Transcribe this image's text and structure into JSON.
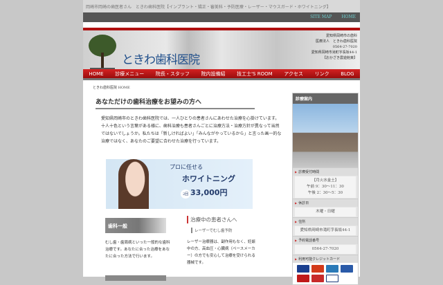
{
  "topbar": {
    "text": "岡崎市岡崎の歯医者さん　ときわ歯科医院【インプラント・矯正・審美科・予防医療・レーザー・マウスガード・ホワイトニング】"
  },
  "util": {
    "sitemap": "SITE MAP",
    "home": "HOME"
  },
  "header": {
    "logo": "ときわ歯科医院",
    "addr": [
      "愛知県岡崎市の歯科",
      "医療法人　ときわ歯科医院",
      "0564-27-7020",
      "愛知県岡崎市滝町字長坂44-1",
      "【おかざき農遊館東】"
    ]
  },
  "nav": [
    "HOME",
    "診療メニュー",
    "院長・スタッフ",
    "院内設備紹",
    "技工士'S ROOM",
    "アクセス",
    "リンク",
    "BLOG"
  ],
  "breadcrumb": "ときわ歯科医院 HOME",
  "main": {
    "heading": "あなただけの歯科治療をお望みの方へ",
    "intro": "愛知県岡崎市のときわ歯科医院では、一人ひとりの患者さんにあわせた治療を心掛けています。十人十色という言葉がある様に、歯科治療も患者さんごとに治療方法・治療方針が異なって当然ではないでしょうか。私たちは「新しければよい」「みんながやっているから」と言った画一的な治療ではなく、あなたのご要望に合わせた治療を行っています。",
    "banner": {
      "l1": "プロに任せる",
      "l2": "ホワイトニング",
      "times": "2回",
      "price": "33,000円"
    },
    "general": {
      "title": "歯科一般",
      "text": "むし歯・歯周病といった一般的な歯科治療です。あなたに合った治療をあなたに合った方法で行います。"
    },
    "patients": {
      "title": "治療中の患者さんへ",
      "sub": "レーザーでむし歯予防",
      "text": "レーザー治療器は、副作用もなく、妊娠中の方、高血圧・心臓病（ペースメーカー）の方でも安心して治療を受けられる器械です。"
    }
  },
  "side": {
    "title": "診療案内",
    "hours_label": "診療受付時間",
    "hours": [
      "【月火水金土】",
      "午前 9：30～11：30",
      "午後 2：30～5：30"
    ],
    "holiday_label": "休診日",
    "holiday": "木曜・日曜",
    "address_label": "住所",
    "address": "愛知県岡崎市滝町字長坂44-1",
    "phone_label": "予約電話番号",
    "phone": "0564-27-7020",
    "cards_label": "利用可能クレジットカード"
  },
  "colors": {
    "nav": "#b01010",
    "accent": "#1f4e8a"
  }
}
